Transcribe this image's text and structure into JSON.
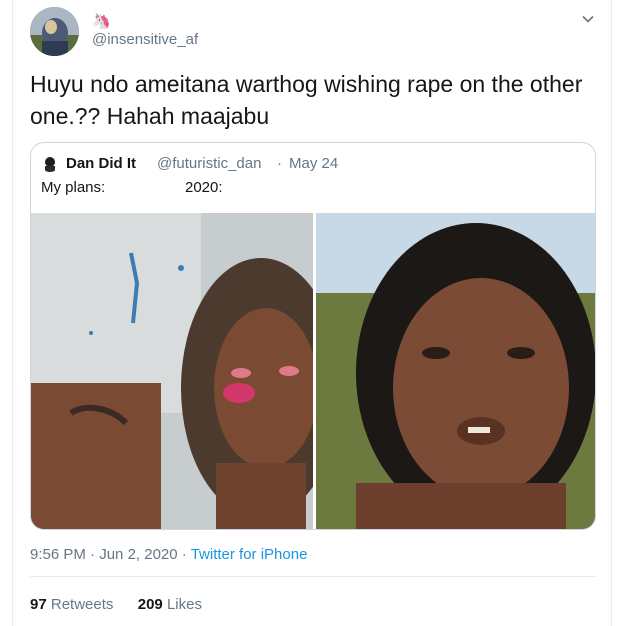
{
  "author": {
    "name_emoji": "🦄",
    "handle": "@insensitive_af"
  },
  "tweet": {
    "text": "Huyu ndo ameitana warthog wishing rape on the other one.?? Hahah maajabu"
  },
  "quoted_tweet": {
    "name": "Dan Did It",
    "handle": "@futuristic_dan",
    "separator": "·",
    "date": "May 24",
    "caption_left": "My plans:",
    "caption_right": "2020:"
  },
  "meta": {
    "time": "9:56 PM",
    "separator": "·",
    "date": "Jun 2, 2020",
    "source": "Twitter for iPhone"
  },
  "stats": {
    "retweets_count": "97",
    "retweets_label": "Retweets",
    "likes_count": "209",
    "likes_label": "Likes"
  },
  "colors": {
    "link": "#1b95e0",
    "secondary_text": "#657786",
    "border": "#ccd6dd"
  },
  "icons": {
    "more": "chevron-down-icon"
  }
}
